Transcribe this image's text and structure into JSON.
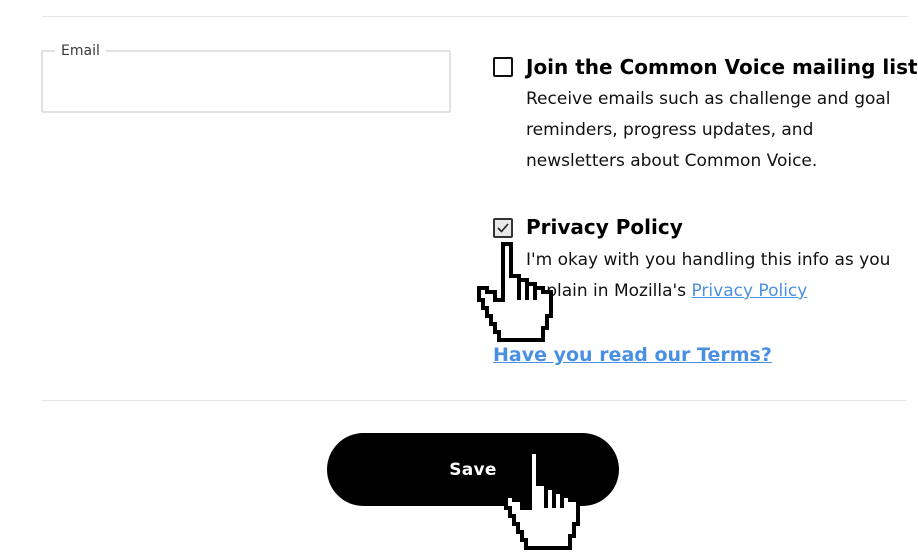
{
  "email": {
    "label": "Email",
    "value": ""
  },
  "mailing_list": {
    "title": "Join the Common Voice mailing list",
    "description": "Receive emails such as challenge and goal reminders, progress updates, and newsletters about Common Voice.",
    "checked": false
  },
  "privacy": {
    "title": "Privacy Policy",
    "description_prefix": "I'm okay with you handling this info as you explain in Mozilla's ",
    "link_label": "Privacy Policy",
    "checked": true
  },
  "terms_link": "Have you read our Terms?",
  "save_button": "Save",
  "icons": {
    "cursor": "hand-pointer-icon",
    "check": "checkmark-icon"
  },
  "colors": {
    "link": "#4a90e2",
    "button_bg": "#000000",
    "button_text": "#ffffff"
  }
}
